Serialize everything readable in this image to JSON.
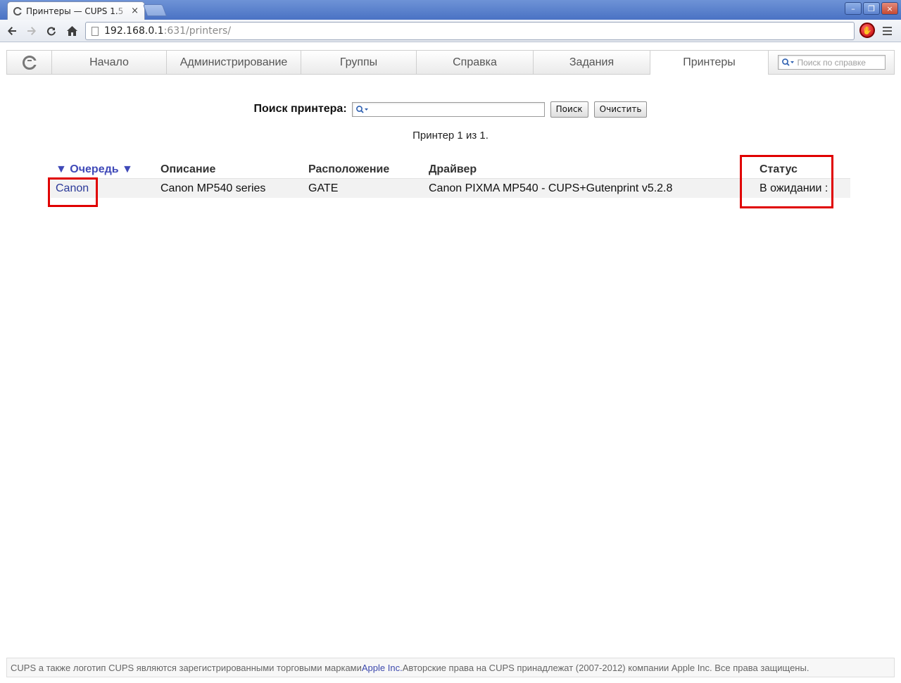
{
  "browser": {
    "tab_title": "Принтеры — CUPS 1.",
    "tab_title_fade": "5",
    "tab_close": "×",
    "url_host": "192.168.0.1",
    "url_rest": ":631/printers/",
    "window_controls": {
      "minimize": "–",
      "restore": "❐",
      "close": "×"
    },
    "icons": {
      "back": "back-arrow-icon",
      "forward": "forward-arrow-icon",
      "reload": "reload-icon",
      "home": "home-icon",
      "extension": "adblock-icon",
      "menu": "wrench-menu-icon"
    }
  },
  "cups_nav": {
    "tabs": [
      "Начало",
      "Администрирование",
      "Группы",
      "Справка",
      "Задания",
      "Принтеры"
    ],
    "active_index": 5,
    "help_search_placeholder": "Поиск по справке"
  },
  "printer_search": {
    "label": "Поиск принтера:",
    "value": "",
    "search_button": "Поиск",
    "clear_button": "Очистить"
  },
  "result_count": "Принтер 1 из 1.",
  "table": {
    "headers": {
      "queue": "▼ Очередь ▼",
      "description": "Описание",
      "location": "Расположение",
      "driver": "Драйвер",
      "status": "Статус"
    },
    "rows": [
      {
        "queue": "Canon",
        "description": "Canon MP540 series",
        "location": "GATE",
        "driver": "Canon PIXMA MP540 - CUPS+Gutenprint v5.2.8",
        "status": "В ожидании :"
      }
    ]
  },
  "footer": {
    "text_before": "CUPS а также логотип CUPS являются зарегистрированными торговыми марками ",
    "link": "Apple Inc.",
    "text_after": " Авторские права на CUPS принадлежат (2007-2012) компании Apple Inc. Все права защищены."
  },
  "colors": {
    "link": "#2b3a99",
    "sort_header": "#3f49b8",
    "highlight": "#e00000",
    "titlebar": "#4a72c4"
  }
}
